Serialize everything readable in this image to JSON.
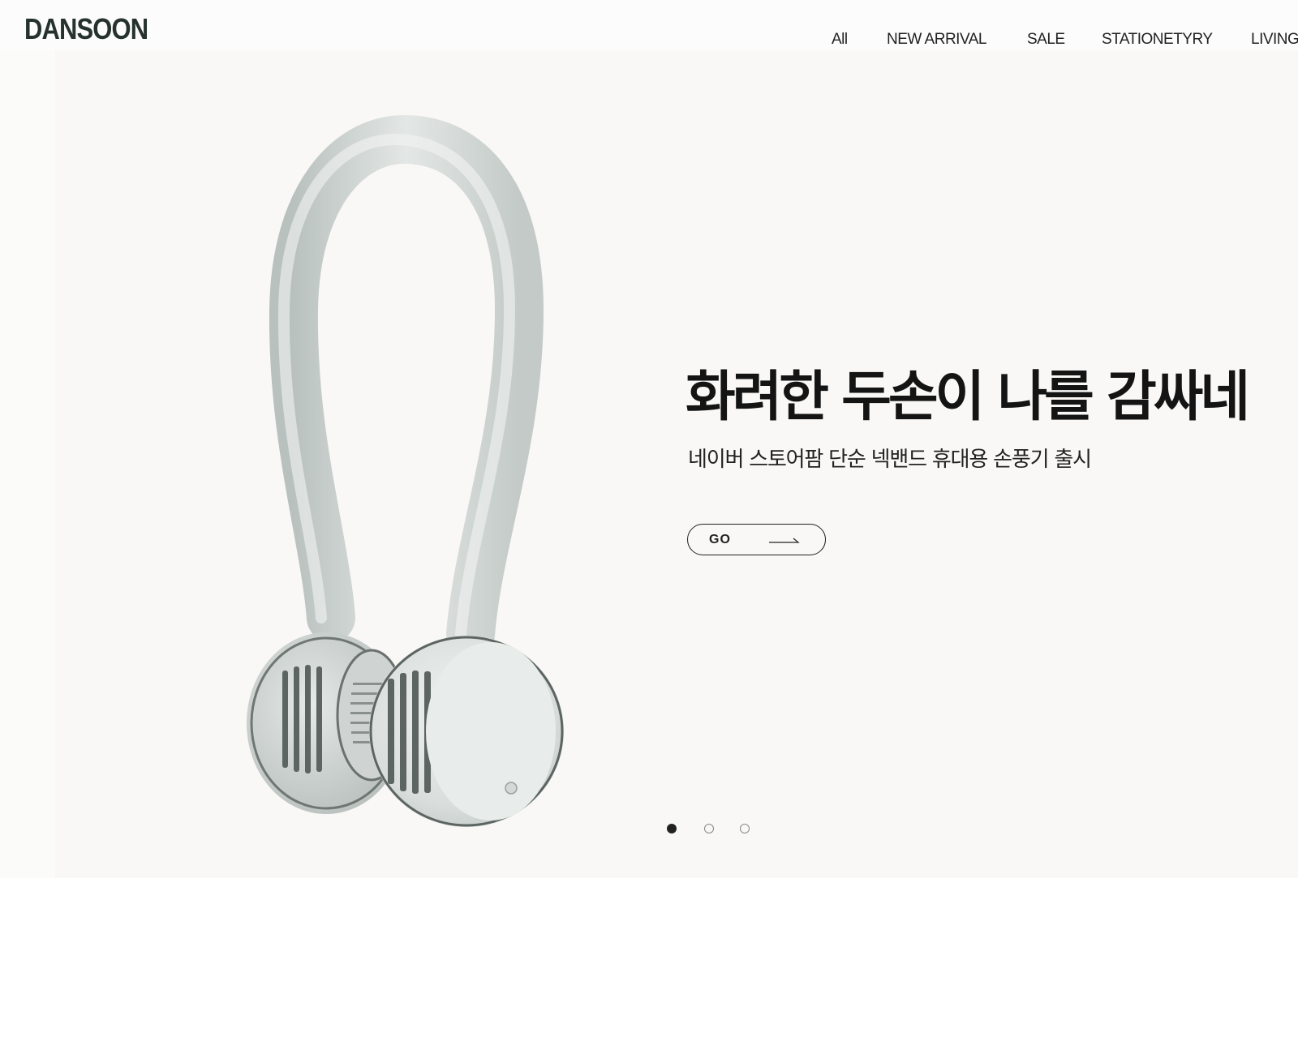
{
  "brand": {
    "logo_text": "DANSOON"
  },
  "nav": {
    "items": [
      {
        "label": "All"
      },
      {
        "label": "NEW ARRIVAL"
      },
      {
        "label": "SALE"
      },
      {
        "label": "STATIONETYRY"
      },
      {
        "label": "LIVING"
      }
    ]
  },
  "hero": {
    "headline": "화려한 두손이 나를 감싸네",
    "subline": "네이버 스토어팜 단순 넥밴드 휴대용 손풍기 출시",
    "cta_label": "GO",
    "product_image": "neckband-fan",
    "slides": {
      "count": 3,
      "active": 1
    }
  },
  "colors": {
    "logo": "#25322d",
    "hero_bg": "#f9f8f7",
    "text": "#141414",
    "product": "#d7dcda"
  }
}
